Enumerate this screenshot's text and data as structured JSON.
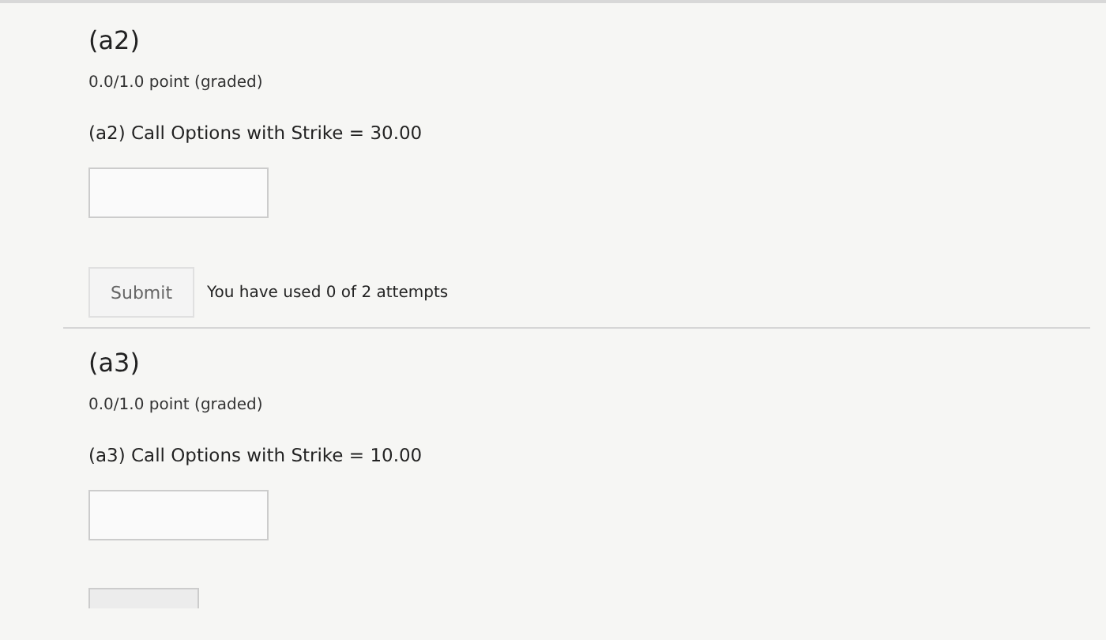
{
  "problems": [
    {
      "title": "(a2)",
      "points": "0.0/1.0 point (graded)",
      "question": "(a2) Call Options with Strike = 30.00",
      "submit": {
        "label": "Submit",
        "attempts": "You have used 0 of 2 attempts"
      }
    },
    {
      "title": "(a3)",
      "points": "0.0/1.0 point (graded)",
      "question": "(a3) Call Options with Strike = 10.00",
      "button_partial": true
    }
  ]
}
